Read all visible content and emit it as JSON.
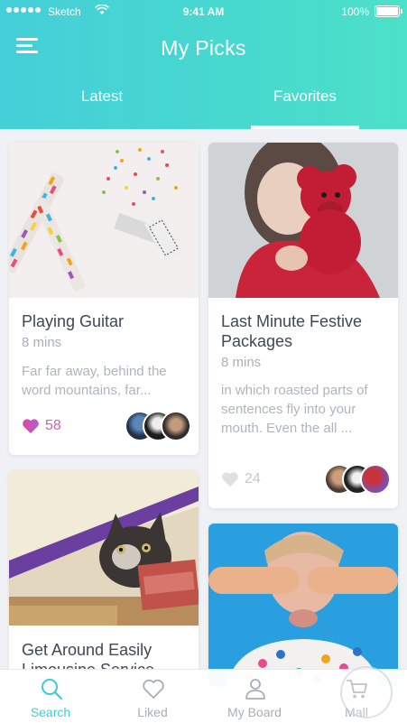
{
  "status_bar": {
    "carrier": "Sketch",
    "time": "9:41 AM",
    "battery": "100%"
  },
  "header": {
    "title": "My Picks",
    "tabs": [
      {
        "label": "Latest",
        "active": false
      },
      {
        "label": "Favorites",
        "active": true
      }
    ]
  },
  "cards": [
    {
      "title": "Playing Guitar",
      "duration": "8 mins",
      "excerpt": "Far far away, behind the word mountains, far...",
      "likes": "58",
      "liked": true
    },
    {
      "title": "Last Minute Festive Packages",
      "duration": "8 mins",
      "excerpt": "in which roasted parts of sentences fly into your mouth. Even the all ...",
      "likes": "24",
      "liked": false
    },
    {
      "title": "Get Around Easily Limousine Service"
    },
    {
      "title": ""
    }
  ],
  "nav": [
    {
      "label": "Search",
      "icon": "search-icon",
      "active": true
    },
    {
      "label": "Liked",
      "icon": "heart-icon",
      "active": false
    },
    {
      "label": "My Board",
      "icon": "user-icon",
      "active": false
    },
    {
      "label": "Mall",
      "icon": "cart-icon",
      "active": false
    }
  ],
  "colors": {
    "accent": "#3fcbd6",
    "header_start": "#45cfd9",
    "header_end": "#4de0c8",
    "like_active": "#d94b9b",
    "like_inactive": "#c9cdd3"
  }
}
